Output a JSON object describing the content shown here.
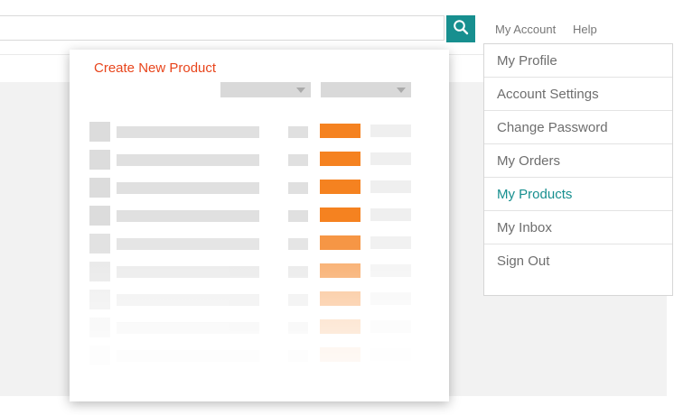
{
  "header": {
    "search": {
      "value": "",
      "placeholder": ""
    },
    "links": [
      "My Account",
      "Help"
    ]
  },
  "product_panel": {
    "title": "Create New Product",
    "rows": 9
  },
  "account_menu": {
    "items": [
      {
        "label": "My Profile",
        "active": false
      },
      {
        "label": "Account Settings",
        "active": false
      },
      {
        "label": "Change Password",
        "active": false
      },
      {
        "label": "My Orders",
        "active": false
      },
      {
        "label": "My Products",
        "active": true
      },
      {
        "label": "My Inbox",
        "active": false
      },
      {
        "label": "Sign Out",
        "active": false
      }
    ]
  },
  "colors": {
    "accent_teal": "#178f8f",
    "title_red": "#e8451c",
    "status_orange": "#f58220"
  }
}
